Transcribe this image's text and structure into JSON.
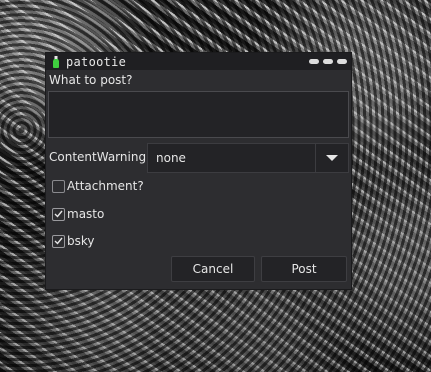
{
  "window": {
    "title": "patootie",
    "icon": "green-bottle-icon"
  },
  "form": {
    "prompt_label": "What to post?",
    "post_text_value": "",
    "content_warning_label": "ContentWarning",
    "content_warning_selected": "none",
    "attachment_label": "Attachment?",
    "attachment_checked": false,
    "masto_label": "masto",
    "masto_checked": true,
    "bsky_label": "bsky",
    "bsky_checked": true
  },
  "buttons": {
    "cancel_label": "Cancel",
    "post_label": "Post"
  },
  "colors": {
    "window_bg": "#2d2d30",
    "titlebar_bg": "#1f1f22",
    "accent_icon": "#3fcf3f"
  }
}
